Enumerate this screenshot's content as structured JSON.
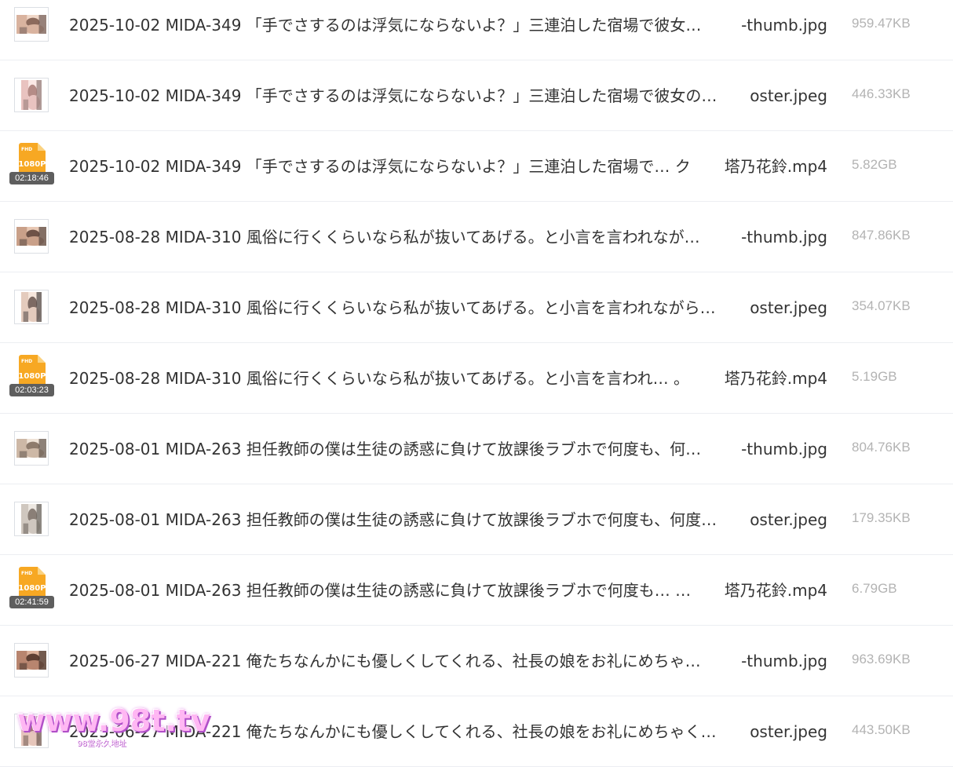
{
  "colors": {
    "text": "#333333",
    "size_text": "#b3b3b3",
    "divider": "#eceef2",
    "video_icon": "#f7a823",
    "duration_badge": "#5e5e5e",
    "watermark": "#ffb7f3"
  },
  "files": [
    {
      "type": "image",
      "icon": "photo-thumbnail",
      "name_main": "2025-10-02 MIDA-349 「手でさするのは浮気にならないよ？」三連泊した宿場で彼女…",
      "name_ext": "-thumb.jpg",
      "size": "959.47KB"
    },
    {
      "type": "image",
      "icon": "photo-thumbnail",
      "name_main": "2025-10-02 MIDA-349 「手でさするのは浮気にならないよ？」三連泊した宿場で彼女の…",
      "name_ext": "oster.jpeg",
      "size": "446.33KB"
    },
    {
      "type": "video",
      "icon": "video-file-icon",
      "badge": "FHD",
      "resolution": "1080P",
      "duration": "02:18:46",
      "name_main": "2025-10-02 MIDA-349 「手でさするのは浮気にならないよ？」三連泊した宿場で… ク",
      "name_ext": "塔乃花鈴.mp4",
      "size": "5.82GB"
    },
    {
      "type": "image",
      "icon": "photo-thumbnail",
      "name_main": "2025-08-28 MIDA-310 風俗に行くくらいなら私が抜いてあげる。と小言を言われなが…",
      "name_ext": "-thumb.jpg",
      "size": "847.86KB"
    },
    {
      "type": "image",
      "icon": "photo-thumbnail",
      "name_main": "2025-08-28 MIDA-310 風俗に行くくらいなら私が抜いてあげる。と小言を言われながら…",
      "name_ext": "oster.jpeg",
      "size": "354.07KB"
    },
    {
      "type": "video",
      "icon": "video-file-icon",
      "badge": "FHD",
      "resolution": "1080P",
      "duration": "02:03:23",
      "name_main": "2025-08-28 MIDA-310 風俗に行くくらいなら私が抜いてあげる。と小言を言われ… 。",
      "name_ext": "塔乃花鈴.mp4",
      "size": "5.19GB"
    },
    {
      "type": "image",
      "icon": "photo-thumbnail",
      "name_main": "2025-08-01 MIDA-263 担任教師の僕は生徒の誘惑に負けて放課後ラブホで何度も、何…",
      "name_ext": "-thumb.jpg",
      "size": "804.76KB"
    },
    {
      "type": "image",
      "icon": "photo-thumbnail",
      "name_main": "2025-08-01 MIDA-263 担任教師の僕は生徒の誘惑に負けて放課後ラブホで何度も、何度…",
      "name_ext": "oster.jpeg",
      "size": "179.35KB"
    },
    {
      "type": "video",
      "icon": "video-file-icon",
      "badge": "FHD",
      "resolution": "1080P",
      "duration": "02:41:59",
      "name_main": "2025-08-01 MIDA-263 担任教師の僕は生徒の誘惑に負けて放課後ラブホで何度も… …",
      "name_ext": "塔乃花鈴.mp4",
      "size": "6.79GB"
    },
    {
      "type": "image",
      "icon": "photo-thumbnail",
      "name_main": "2025-06-27 MIDA-221 俺たちなんかにも優しくしてくれる、社長の娘をお礼にめちゃ…",
      "name_ext": "-thumb.jpg",
      "size": "963.69KB"
    },
    {
      "type": "image",
      "icon": "photo-thumbnail",
      "name_main": "2025-06-27 MIDA-221 俺たちなんかにも優しくしてくれる、社長の娘をお礼にめちゃく…",
      "name_ext": "oster.jpeg",
      "size": "443.50KB"
    }
  ],
  "watermark": {
    "text": "www.98t.tv",
    "subtitle": "98堂永久地址"
  }
}
